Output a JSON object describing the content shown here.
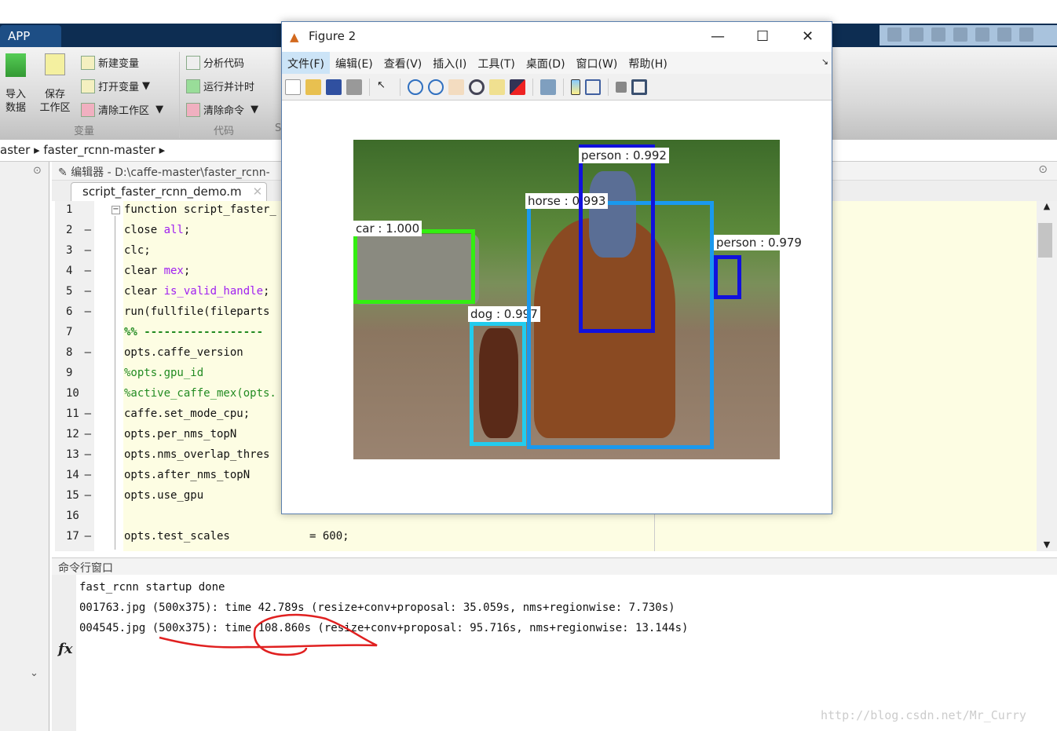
{
  "app_tab": "APP",
  "ribbon": {
    "import_data": "导入\n数据",
    "save_workspace": "保存\n工作区",
    "new_variable": "新建变量",
    "open_variable": "打开变量",
    "clear_workspace": "清除工作区",
    "analyze_code": "分析代码",
    "run_and_time": "运行并计时",
    "clear_commands": "清除命令",
    "group_variable": "变量",
    "group_code": "代码",
    "group_s": "S"
  },
  "breadcrumb": [
    "aster",
    "faster_rcnn-master"
  ],
  "editor": {
    "header": "编辑器 - D:\\caffe-master\\faster_rcnn-",
    "tab": "script_faster_rcnn_demo.m",
    "lines": [
      {
        "n": "1",
        "dash": "",
        "code": "function script_faster_",
        "type": "fn"
      },
      {
        "n": "2",
        "dash": "—",
        "pre": "close ",
        "str": "all",
        "post": ";"
      },
      {
        "n": "3",
        "dash": "—",
        "code": "clc;"
      },
      {
        "n": "4",
        "dash": "—",
        "pre": "clear ",
        "str": "mex",
        "post": ";"
      },
      {
        "n": "5",
        "dash": "—",
        "pre": "clear ",
        "str": "is_valid_handle",
        "post": ";"
      },
      {
        "n": "6",
        "dash": "—",
        "code": "run(fullfile(fileparts"
      },
      {
        "n": "7",
        "dash": "",
        "code": "%% ------------------",
        "type": "cell"
      },
      {
        "n": "8",
        "dash": "—",
        "code": "opts.caffe_version"
      },
      {
        "n": "9",
        "dash": "",
        "code": "%opts.gpu_id",
        "type": "comment"
      },
      {
        "n": "10",
        "dash": "",
        "code": "%active_caffe_mex(opts.",
        "type": "comment"
      },
      {
        "n": "11",
        "dash": "—",
        "code": "caffe.set_mode_cpu;"
      },
      {
        "n": "12",
        "dash": "—",
        "code": "opts.per_nms_topN"
      },
      {
        "n": "13",
        "dash": "—",
        "code": "opts.nms_overlap_thres"
      },
      {
        "n": "14",
        "dash": "—",
        "code": "opts.after_nms_topN"
      },
      {
        "n": "15",
        "dash": "—",
        "code": "opts.use_gpu"
      },
      {
        "n": "16",
        "dash": "",
        "code": ""
      },
      {
        "n": "17",
        "dash": "—",
        "code": "opts.test_scales            = 600;"
      }
    ]
  },
  "command_window": {
    "title": "命令行窗口",
    "lines": [
      "fast_rcnn startup done",
      "001763.jpg (500x375): time 42.789s (resize+conv+proposal: 35.059s, nms+regionwise: 7.730s)",
      "004545.jpg (500x375): time 108.860s (resize+conv+proposal: 95.716s, nms+regionwise: 13.144s)"
    ],
    "prompt": "fx"
  },
  "figure": {
    "title": "Figure 2",
    "menu": [
      "文件(F)",
      "编辑(E)",
      "查看(V)",
      "插入(I)",
      "工具(T)",
      "桌面(D)",
      "窗口(W)",
      "帮助(H)"
    ],
    "toolbar": [
      "new-icon",
      "open-icon",
      "save-icon",
      "print-icon",
      "pointer-icon",
      "zoom-in-icon",
      "zoom-out-icon",
      "pan-icon",
      "rotate-icon",
      "data-cursor-icon",
      "brush-icon",
      "link-icon",
      "colorbar-icon",
      "legend-icon",
      "hide-plot-tools-icon",
      "show-plot-tools-icon"
    ],
    "detections": [
      {
        "label": "car : 1.000",
        "color": "#33ee11"
      },
      {
        "label": "dog : 0.997",
        "color": "#22ccee"
      },
      {
        "label": "horse : 0.993",
        "color": "#1a99ee"
      },
      {
        "label": "person : 0.992",
        "color": "#1111dd"
      },
      {
        "label": "person : 0.979",
        "color": "#1111dd"
      }
    ]
  },
  "watermark": "http://blog.csdn.net/Mr_Curry"
}
